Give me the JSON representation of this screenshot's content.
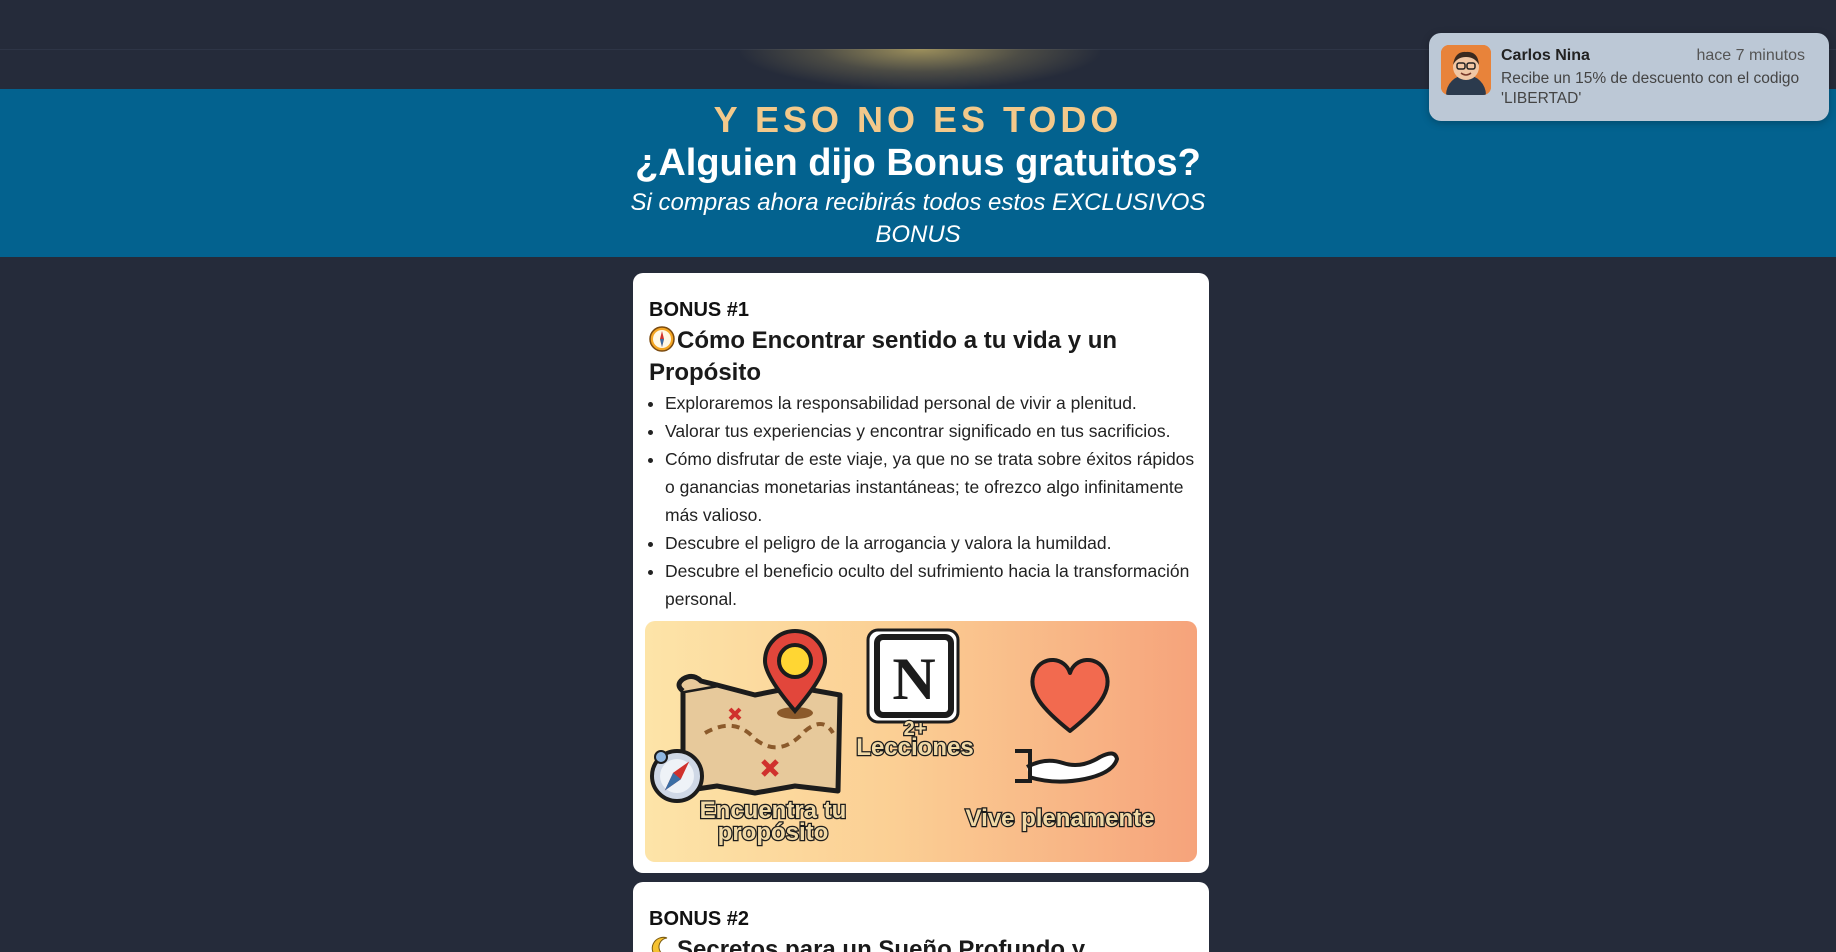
{
  "hero": {
    "kicker": "Y ESO NO ES TODO",
    "title": "¿Alguien dijo Bonus gratuitos?",
    "subtitle": "Si compras ahora recibirás todos estos EXCLUSIVOS BONUS"
  },
  "bonuses": [
    {
      "label": "BONUS #1",
      "icon": "compass-icon",
      "title": "Cómo Encontrar sentido a tu vida y un Propósito",
      "bullets": [
        "Exploraremos la responsabilidad personal de vivir a plenitud.",
        "Valorar tus experiencias y encontrar significado en tus sacrificios.",
        "Cómo disfrutar de este viaje, ya que no se trata sobre éxitos rápidos o ganancias monetarias instantáneas; te ofrezco algo infinitamente más valioso.",
        "Descubre el peligro de la arrogancia y valora la humildad.",
        "Descubre el beneficio oculto del sufrimiento hacia la transformación personal."
      ],
      "banner": {
        "left_caption_line1": "Encuentra tu",
        "left_caption_line2": "propósito",
        "center_count": "2+",
        "center_caption": "Lecciones",
        "right_caption": "Vive plenamente",
        "logo_letter": "N"
      }
    },
    {
      "label": "BONUS #2",
      "icon": "moon-icon",
      "title": "Secretos para un Sueño Profundo y"
    }
  ],
  "notification": {
    "name": "Carlos Nina",
    "time": "hace 7 minutos",
    "message": "Recibe un 15% de descuento con el codigo 'LIBERTAD'"
  },
  "colors": {
    "page_bg": "#252b3a",
    "hero_bg": "#03628f",
    "kicker": "#f3c98b"
  }
}
